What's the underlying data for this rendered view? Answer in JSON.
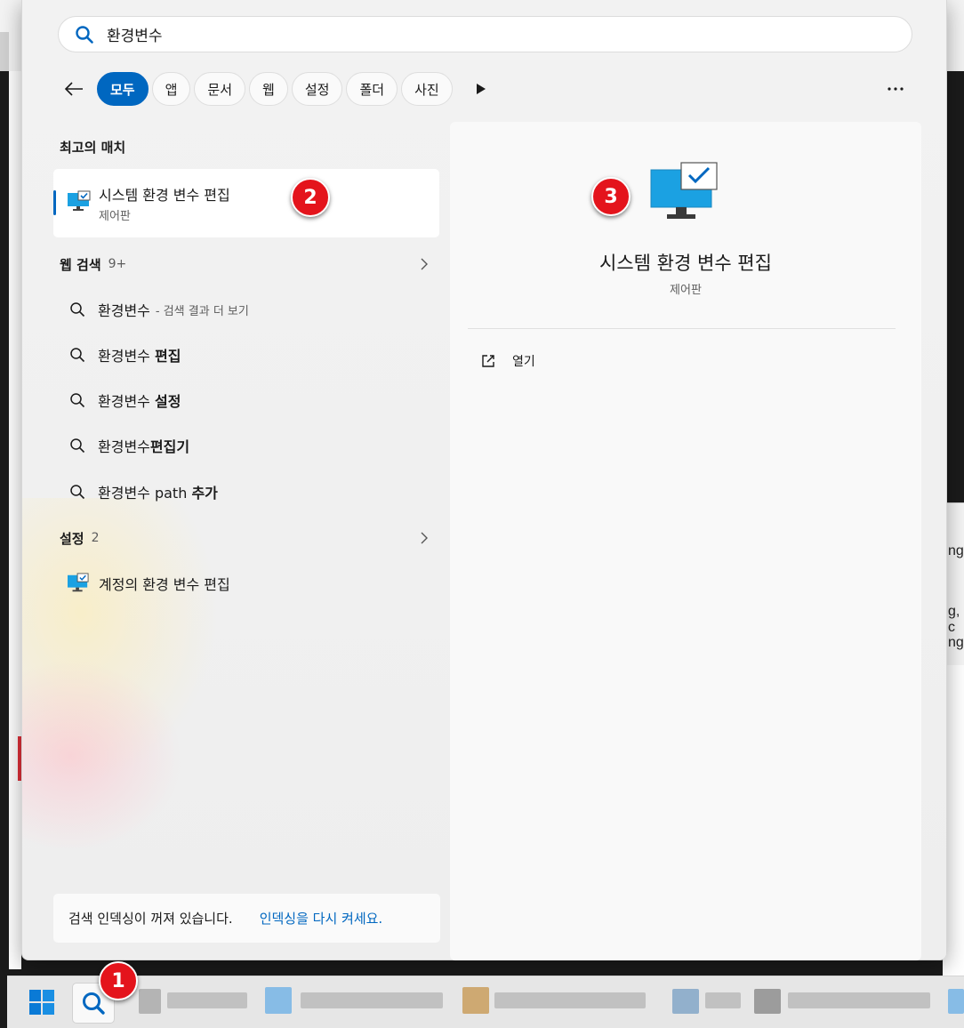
{
  "search": {
    "query": "환경변수"
  },
  "filters": {
    "items": [
      "모두",
      "앱",
      "문서",
      "웹",
      "설정",
      "폴더",
      "사진"
    ],
    "active_index": 0
  },
  "best_match": {
    "section_title": "최고의 매치",
    "title": "시스템 환경 변수 편집",
    "subtitle": "제어판"
  },
  "web_search": {
    "title": "웹 검색",
    "count": "9+",
    "items": [
      {
        "prefix": "환경변수",
        "bold": "",
        "hint": "- 검색 결과 더 보기"
      },
      {
        "prefix": "환경변수 ",
        "bold": "편집",
        "hint": ""
      },
      {
        "prefix": "환경변수 ",
        "bold": "설정",
        "hint": ""
      },
      {
        "prefix": "환경변수",
        "bold": "편집기",
        "hint": ""
      },
      {
        "prefix": "환경변수 path ",
        "bold": "추가",
        "hint": ""
      }
    ]
  },
  "settings_group": {
    "title": "설정",
    "count": "2",
    "items": [
      {
        "label": "계정의 환경 변수 편집"
      }
    ]
  },
  "indexing": {
    "message": "검색 인덱싱이 꺼져 있습니다.",
    "link": "인덱싱을 다시 켜세요."
  },
  "detail": {
    "title": "시스템 환경 변수 편집",
    "subtitle": "제어판",
    "open_label": "열기"
  },
  "badges": {
    "b1": "1",
    "b2": "2",
    "b3": "3"
  },
  "background": {
    "right_text_1": "ng",
    "right_text_2": "g, c",
    "right_text_3": "ng"
  },
  "colors": {
    "accent": "#0067c0",
    "badge": "#e4141c"
  }
}
